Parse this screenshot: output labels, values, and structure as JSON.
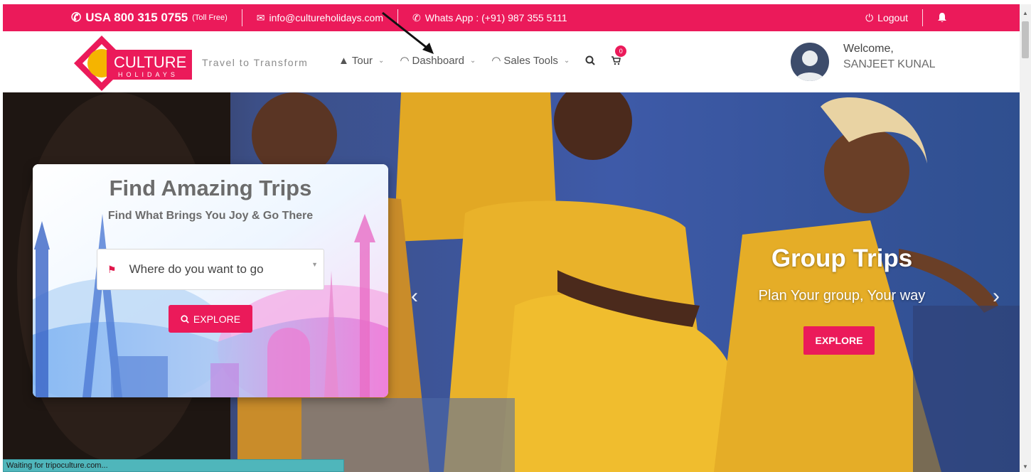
{
  "topbar": {
    "phone": "USA 800 315 0755",
    "phone_note": "(Toll Free)",
    "email": "info@cultureholidays.com",
    "whatsapp": "Whats App : (+91) 987 355 5111",
    "logout": "Logout",
    "bell_icon": "bell-icon"
  },
  "brand": {
    "name_top": "CULTURE",
    "name_bottom": "HOLIDAYS",
    "tagline": "Travel to Transform"
  },
  "menu": {
    "items": [
      {
        "label": "Tour",
        "icon": "tour-icon"
      },
      {
        "label": "Dashboard",
        "icon": "dashboard-icon"
      },
      {
        "label": "Sales Tools",
        "icon": "gauge-icon"
      }
    ],
    "cart_count": "0"
  },
  "user": {
    "greeting": "Welcome,",
    "name": "SANJEET KUNAL"
  },
  "search_card": {
    "title": "Find Amazing Trips",
    "subtitle": "Find What Brings You Joy & Go There",
    "select_placeholder": "Where do you want to go",
    "button": "EXPLORE"
  },
  "slide": {
    "title": "Group Trips",
    "subtitle": "Plan Your group, Your way",
    "button": "EXPLORE"
  },
  "status": "Waiting for tripoculture.com...",
  "colors": {
    "accent": "#eb1a5a",
    "brand_yellow": "#f5b400"
  }
}
